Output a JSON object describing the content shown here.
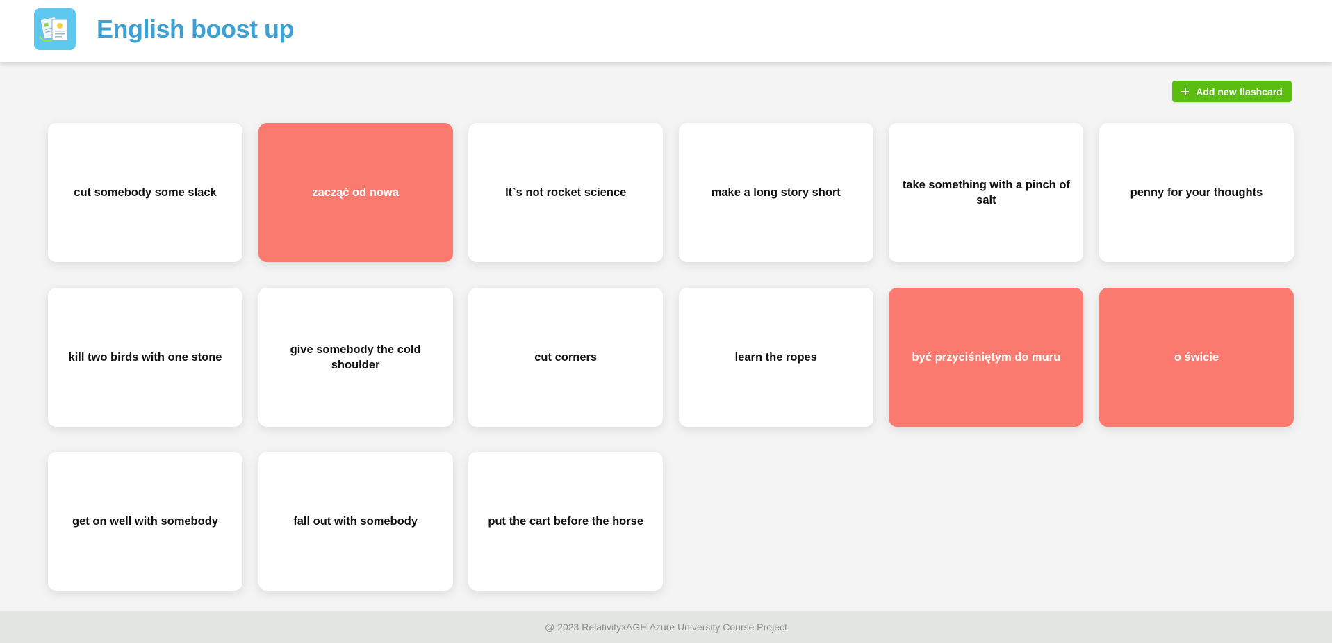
{
  "header": {
    "title": "English boost up",
    "logo_icon": "flashcards-icon"
  },
  "toolbar": {
    "add_label": "Add new flashcard",
    "add_icon": "plus-icon",
    "accent_color": "#5bbd10"
  },
  "colors": {
    "card_front": "#ffffff",
    "card_back": "#fa7a6f",
    "title": "#3ea1d1",
    "logo_bg": "#5fc8ef"
  },
  "flashcards": [
    {
      "text": "cut somebody some slack",
      "flipped": false
    },
    {
      "text": "zacząć od nowa",
      "flipped": true
    },
    {
      "text": "It`s not rocket science",
      "flipped": false
    },
    {
      "text": "make a long story short",
      "flipped": false
    },
    {
      "text": "take something with a pinch of salt",
      "flipped": false
    },
    {
      "text": "penny for your thoughts",
      "flipped": false
    },
    {
      "text": "kill two birds with one stone",
      "flipped": false
    },
    {
      "text": "give somebody the cold shoulder",
      "flipped": false
    },
    {
      "text": "cut corners",
      "flipped": false
    },
    {
      "text": "learn the ropes",
      "flipped": false
    },
    {
      "text": "być przyciśniętym do muru",
      "flipped": true
    },
    {
      "text": "o świcie",
      "flipped": true
    },
    {
      "text": "get on well with somebody",
      "flipped": false
    },
    {
      "text": "fall out with somebody",
      "flipped": false
    },
    {
      "text": "put the cart before the horse",
      "flipped": false
    }
  ],
  "footer": {
    "text": "@ 2023 RelativityxAGH Azure University Course Project"
  }
}
